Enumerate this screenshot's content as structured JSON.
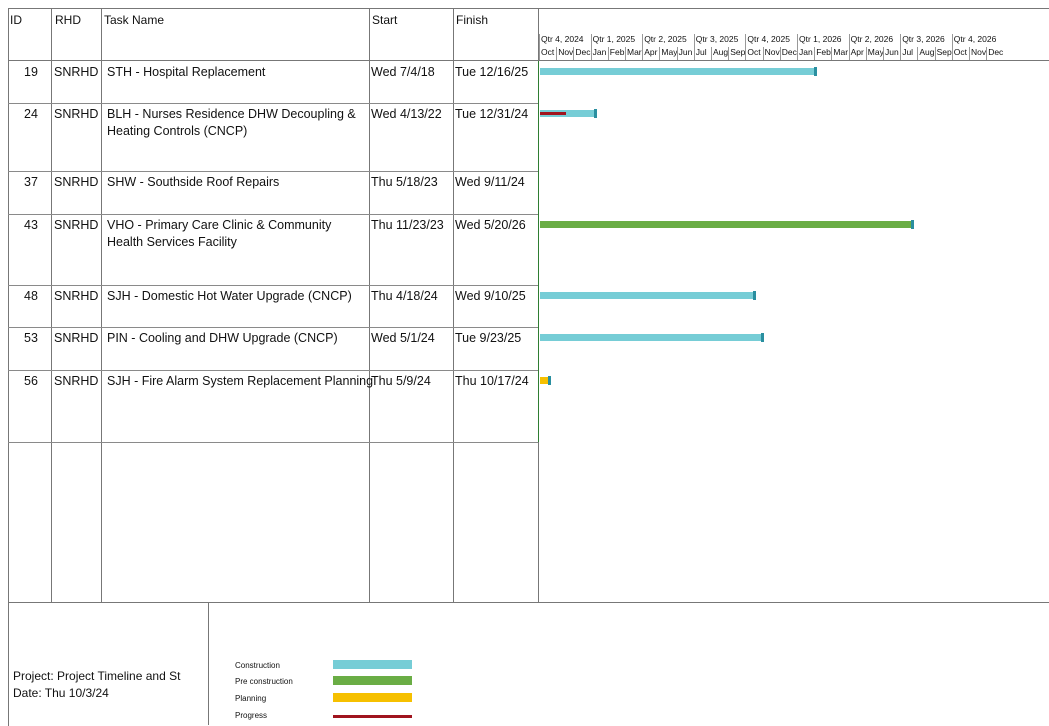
{
  "headers": {
    "id": "ID",
    "rhd": "RHD",
    "task": "Task Name",
    "start": "Start",
    "finish": "Finish"
  },
  "timeline": {
    "quarters": [
      "Qtr 4, 2024",
      "Qtr 1, 2025",
      "Qtr 2, 2025",
      "Qtr 3, 2025",
      "Qtr 4, 2025",
      "Qtr 1, 2026",
      "Qtr 2, 2026",
      "Qtr 3, 2026",
      "Qtr 4, 2026"
    ],
    "months": [
      "Oct",
      "Nov",
      "Dec",
      "Jan",
      "Feb",
      "Mar",
      "Apr",
      "May",
      "Jun",
      "Jul",
      "Aug",
      "Sep",
      "Oct",
      "Nov",
      "Dec",
      "Jan",
      "Feb",
      "Mar",
      "Apr",
      "May",
      "Jun",
      "Jul",
      "Aug",
      "Sep",
      "Oct",
      "Nov",
      "Dec"
    ]
  },
  "rows": [
    {
      "id": "19",
      "rhd": "SNRHD",
      "task_line1": "STH - Hospital Replacement",
      "task_line2": "",
      "start": "Wed 7/4/18",
      "finish": "Tue 12/16/25",
      "type": "Construction",
      "progress": false
    },
    {
      "id": "24",
      "rhd": "SNRHD",
      "task_line1": "BLH - Nurses Residence DHW Decoupling &",
      "task_line2": "Heating Controls (CNCP)",
      "start": "Wed 4/13/22",
      "finish": "Tue 12/31/24",
      "type": "Construction",
      "progress": true
    },
    {
      "id": "37",
      "rhd": "SNRHD",
      "task_line1": "SHW - Southside Roof Repairs",
      "task_line2": "",
      "start": "Thu 5/18/23",
      "finish": "Wed 9/11/24",
      "type": "",
      "progress": false
    },
    {
      "id": "43",
      "rhd": "SNRHD",
      "task_line1": "VHO - Primary Care Clinic & Community",
      "task_line2": "Health Services Facility",
      "start": "Thu 11/23/23",
      "finish": "Wed 5/20/26",
      "type": "Pre construction",
      "progress": false
    },
    {
      "id": "48",
      "rhd": "SNRHD",
      "task_line1": "SJH - Domestic Hot Water Upgrade (CNCP)",
      "task_line2": "",
      "start": "Thu 4/18/24",
      "finish": "Wed 9/10/25",
      "type": "Construction",
      "progress": false
    },
    {
      "id": "53",
      "rhd": "SNRHD",
      "task_line1": "PIN - Cooling and DHW Upgrade (CNCP)",
      "task_line2": "",
      "start": "Wed 5/1/24",
      "finish": "Tue 9/23/25",
      "type": "Construction",
      "progress": false
    },
    {
      "id": "56",
      "rhd": "SNRHD",
      "task_line1": "SJH - Fire Alarm System Replacement Planning",
      "task_line2": "",
      "start": "Thu 5/9/24",
      "finish": "Thu 10/17/24",
      "type": "Planning",
      "progress": false
    }
  ],
  "footer": {
    "project": "Project: Project Timeline and St",
    "date": "Date: Thu 10/3/24"
  },
  "legend": [
    {
      "label": "Construction",
      "color": "#76cdd6"
    },
    {
      "label": "Pre construction",
      "color": "#6aad45"
    },
    {
      "label": "Planning",
      "color": "#f6c000"
    },
    {
      "label": "Progress",
      "color": "#a0141e"
    }
  ],
  "colors": {
    "construction": "#76cdd6",
    "preconstruction": "#6aad45",
    "planning": "#f6c000",
    "progress": "#a0141e",
    "today_line": "#2e7d32"
  }
}
